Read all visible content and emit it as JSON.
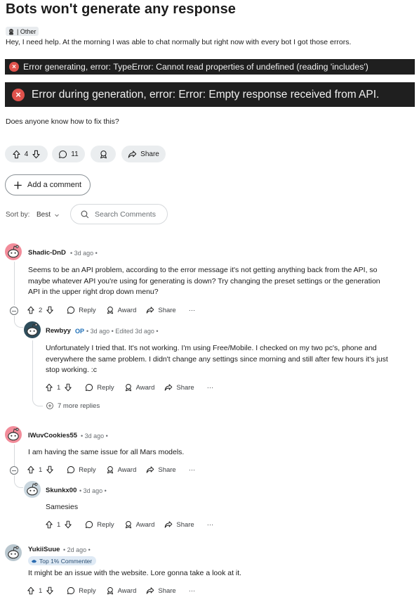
{
  "post": {
    "title": "Bots won't generate any response",
    "flair": "| Other",
    "body_line1": "Hey, I need help. At the morning I was able to chat normally but right now with every bot I got those errors.",
    "error1": "Error generating, error: TypeError: Cannot read properties of undefined (reading 'includes')",
    "error2": "Error during generation, error: Error: Empty response received from API.",
    "body_line2": "Does anyone know how to fix this?",
    "votes": "4",
    "comments_count": "11",
    "share_label": "Share"
  },
  "add_comment_label": "Add a comment",
  "sort": {
    "label": "Sort by:",
    "value": "Best"
  },
  "search": {
    "placeholder": "Search Comments"
  },
  "labels": {
    "reply": "Reply",
    "award": "Award",
    "share": "Share",
    "more": "···"
  },
  "comments": [
    {
      "user": "Shadic-DnD",
      "meta": "• 3d ago •",
      "text": "Seems to be an API problem, according to the error message it's not getting anything back from the API, so\nmaybe whatever API you're using for generating is down? Try changing the preset settings or the generation\nAPI in the upper right drop down menu?",
      "votes": "2",
      "avatar_color": "#f28c9a"
    },
    {
      "user": "Rewbyy",
      "op": "OP",
      "meta": "• 3d ago • Edited 3d ago •",
      "text": "Unfortunately I tried that. It's not working. I'm using Free/Mobile. I checked on my two pc's, phone and\neverywhere the same problem. I didn't change any settings since morning and still after few hours it's just\nstop working. :c",
      "votes": "1",
      "more_replies": "7 more replies",
      "avatar_color": "#2f4e5c"
    },
    {
      "user": "IWuvCookies55",
      "meta": "• 3d ago •",
      "text": "I am having the same issue for all Mars models.",
      "votes": "1",
      "avatar_color": "#f28c9a"
    },
    {
      "user": "Skunkx00",
      "meta": "• 3d ago •",
      "text": "Samesies",
      "votes": "1",
      "avatar_color": "#c9d6de"
    },
    {
      "user": "YukiiSuue",
      "meta": "• 2d ago •",
      "badge": "Top 1% Commenter",
      "text": "It might be an issue with the website. Lore gonna take a look at it.",
      "votes": "1",
      "avatar_color": "#b9c7cf"
    }
  ]
}
